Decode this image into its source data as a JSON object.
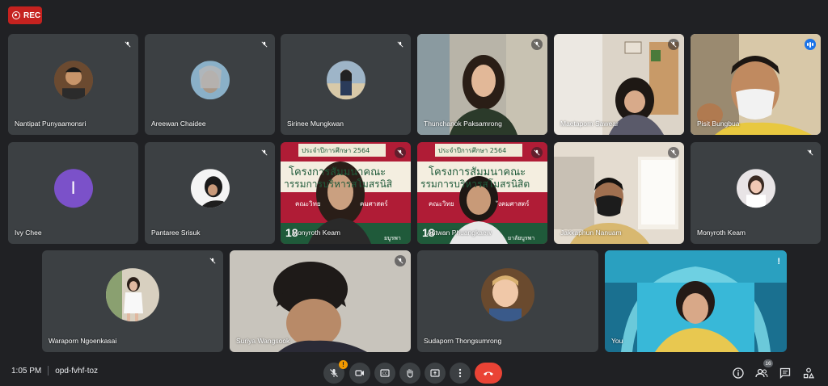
{
  "rec_label": "REC",
  "tiles": [
    {
      "name": "Nantipat Punyaamonsri",
      "kind": "avatar-photo",
      "avatar_color": "#8a6a4a"
    },
    {
      "name": "Areewan Chaidee",
      "kind": "avatar-photo",
      "avatar_color": "#9aa0a6"
    },
    {
      "name": "Sirinee Mungkwan",
      "kind": "avatar-photo",
      "avatar_color": "#6d7b8c"
    },
    {
      "name": "Thunchanok Paksamrong",
      "kind": "video"
    },
    {
      "name": "Maetaporn Sawear",
      "kind": "video"
    },
    {
      "name": "Pisit Bungbua",
      "kind": "video",
      "speaking": true
    },
    {
      "name": "Ivy Chee",
      "kind": "avatar-letter",
      "letter": "I",
      "avatar_color": "#7b51c9"
    },
    {
      "name": "Pantaree Srisuk",
      "kind": "avatar-photo",
      "avatar_color": "#3c3c3c"
    },
    {
      "name": "Monyroth Keam",
      "kind": "video",
      "banner_year": "ประจำปีการศึกษา 2564",
      "banner_line1": "โครงการสัมมนาคณะ",
      "banner_line2": "ารรมการบริหารสโมสรนิสิ",
      "banner_line3": "คณะวิทย",
      "banner_line3b": "คมศาสตร์",
      "banner_num": "18",
      "banner_bottom": "ยบูรพา"
    },
    {
      "name": "Aritwan Phuangkaew",
      "kind": "video",
      "banner_year": "ประจำปีการศึกษา 2564",
      "banner_line1": "โครงการสัมมนาคณะ",
      "banner_line2": "รรมการบริหารสโมสรนิสิต",
      "banner_line3": "คณะวิทย",
      "banner_line3b": "ังคมศาสตร์",
      "banner_num": "18",
      "banner_bottom": "ยาลัยบูรพา"
    },
    {
      "name": "Jakkaphun Nanuam",
      "kind": "video"
    },
    {
      "name": "Monyroth Keam",
      "kind": "avatar-photo",
      "avatar_color": "#d8d0d0"
    },
    {
      "name": "Waraporn Ngoenkasai",
      "kind": "avatar-photo",
      "avatar_color": "#cfc7b8"
    },
    {
      "name": "Suriya Wangsook",
      "kind": "video"
    },
    {
      "name": "Sudaporn Thongsumrong",
      "kind": "avatar-photo",
      "avatar_color": "#7a5a3a"
    },
    {
      "name": "You",
      "kind": "video"
    }
  ],
  "bottom": {
    "time": "1:05 PM",
    "meeting_code": "opd-fvhf-toz",
    "mic_badge": "!",
    "participant_count": "16"
  },
  "icons": [
    "mic-off-icon",
    "videocam-icon",
    "captions-icon",
    "raise-hand-icon",
    "present-icon",
    "more-vert-icon",
    "call-end-icon",
    "info-icon",
    "people-icon",
    "chat-icon",
    "activities-icon"
  ],
  "colors": {
    "background": "#202124",
    "tile": "#3c4043",
    "rec": "#c5221f",
    "end_call": "#ea4335",
    "speaking": "#8ab4f8"
  }
}
